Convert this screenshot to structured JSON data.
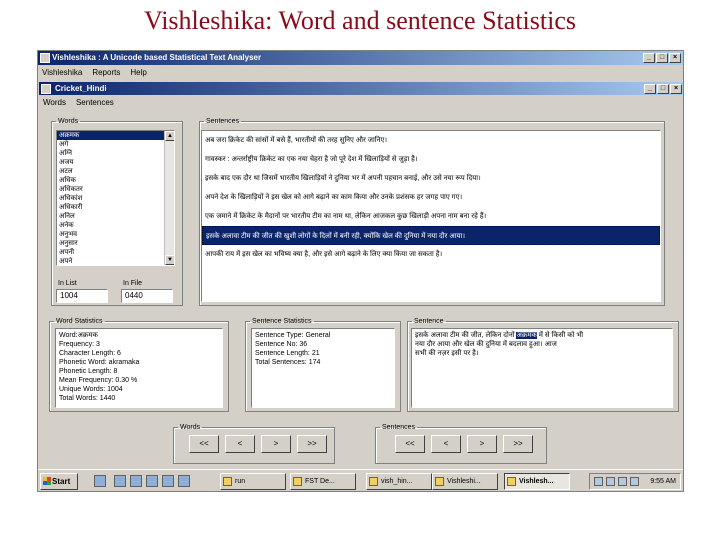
{
  "slide_title": "Vishleshika: Word and sentence Statistics",
  "app": {
    "title": "Vishleshika : A Unicode based Statistical Text Analyser",
    "menu": [
      "Vishleshika",
      "Reports",
      "Help"
    ]
  },
  "child": {
    "title": "Cricket_Hindi",
    "menu": [
      "Words",
      "Sentences"
    ]
  },
  "words_group": {
    "legend": "Words",
    "items": [
      "अक्रमक",
      "अगे",
      "अग्नि",
      "अजय",
      "अटल",
      "अधिक",
      "अधिकतर",
      "अधिकांश",
      "अधिकारी",
      "अनिल",
      "अनेक",
      "अनुभव",
      "अनुसार",
      "अपनी",
      "अपने",
      "अपनाया",
      "अब",
      "अभी"
    ],
    "selected_index": 0,
    "in_list_label": "In List",
    "in_list_value": "1004",
    "in_file_label": "In File",
    "in_file_value": "0440"
  },
  "sentences_group": {
    "legend": "Sentences",
    "items": [
      "अब जरा क्रिकेट की सांसों में बसे हैं, भारतीयों की तरह सुनिए और जानिए।",
      "गावस्कर :   अन्तर्राष्ट्रीय क्रिकेट का एक नया चेहरा है जो पूरे देश में खिलाड़ियों से जुड़ा है।",
      "इसके बाद एक दौर था जिसमें भारतीय खिलाड़ियों ने दुनिया भर में अपनी पहचान बनाई, और उसे नया रूप दिया।",
      "अपने देश के खिलाड़ियों ने इस खेल को आगे बढ़ाने का काम किया और उनके प्रशंसक हर जगह पाए गए।",
      "एक जमाने में क्रिकेट के मैदानों पर भारतीय टीम का नाम था, लेकिन आजकल कुछ खिलाड़ी अपना नाम बना रहे हैं।",
      "इसके अलावा टीम की जीत की खुशी लोगों के दिलों में बनी रही, क्योंकि खेल की दुनिया में नया दौर आया।",
      "आपकी राय में इस खेल का भविष्य क्या है, और इसे आगे बढ़ाने के लिए क्या किया जा सकता है।"
    ],
    "highlighted_index": 5
  },
  "word_stats": {
    "legend": "Word Statistics",
    "lines": [
      "Word:अक्रमक",
      "Frequency: 3",
      "Character Length: 6",
      "Phonetic Word: akramaka",
      "Phonetic Length: 8",
      "Mean Frequency: 0.30 %",
      "Unique Words: 1004",
      "Total Words: 1440"
    ]
  },
  "sentence_stats": {
    "legend": "Sentence Statistics",
    "lines": [
      "Sentence Type: General",
      "Sentence No: 36",
      "Sentence Length: 21",
      "Total Sentences: 174"
    ]
  },
  "sentence_view": {
    "legend": "Sentence",
    "lines": [
      [
        "इसके अलावा टीम की जीत, लेकिन दोनों ",
        "अक्रमक",
        " में से किसी को भी"
      ],
      [
        "नया दौर आया और खेल की दुनिया में बदलाव हुआ। आज"
      ],
      [
        "सभी की नज़र इसी पर है।"
      ]
    ]
  },
  "nav": {
    "words_legend": "Words",
    "sentences_legend": "Sentences",
    "buttons": [
      "<<",
      "<",
      ">",
      ">>"
    ]
  },
  "taskbar": {
    "start": "Start",
    "tasks": [
      "run",
      "FST De...",
      "vish_hin...",
      "Vishleshi...",
      "Vishlesh..."
    ],
    "active_index": 4,
    "clock": "9:55 AM"
  },
  "colors": {
    "title_red": "#8b0a18",
    "selection": "#0a246a",
    "face": "#d4d0c8"
  }
}
